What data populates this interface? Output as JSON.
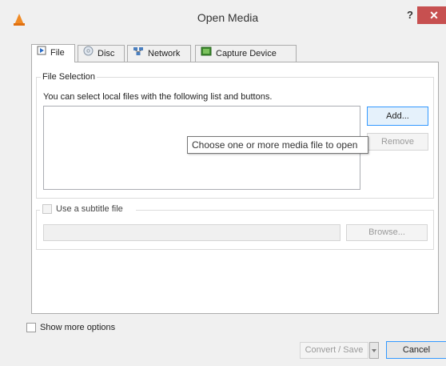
{
  "window": {
    "title": "Open Media",
    "help_label": "?",
    "close_label": "✕"
  },
  "tabs": [
    {
      "label": "File",
      "icon": "file-icon"
    },
    {
      "label": "Disc",
      "icon": "disc-icon"
    },
    {
      "label": "Network",
      "icon": "network-icon"
    },
    {
      "label": "Capture Device",
      "icon": "capture-device-icon"
    }
  ],
  "file_selection": {
    "group_title": "File Selection",
    "description": "You can select local files with the following list and buttons.",
    "add_label": "Add...",
    "remove_label": "Remove",
    "tooltip": "Choose one or more media file to open"
  },
  "subtitle": {
    "checkbox_label": "Use a subtitle file",
    "browse_label": "Browse..."
  },
  "footer": {
    "show_more_label": "Show more options",
    "convert_label": "Convert / Save",
    "cancel_label": "Cancel"
  },
  "colors": {
    "close_button": "#c75050",
    "focus_border": "#3399ff",
    "vlc_orange": "#f08a24"
  }
}
